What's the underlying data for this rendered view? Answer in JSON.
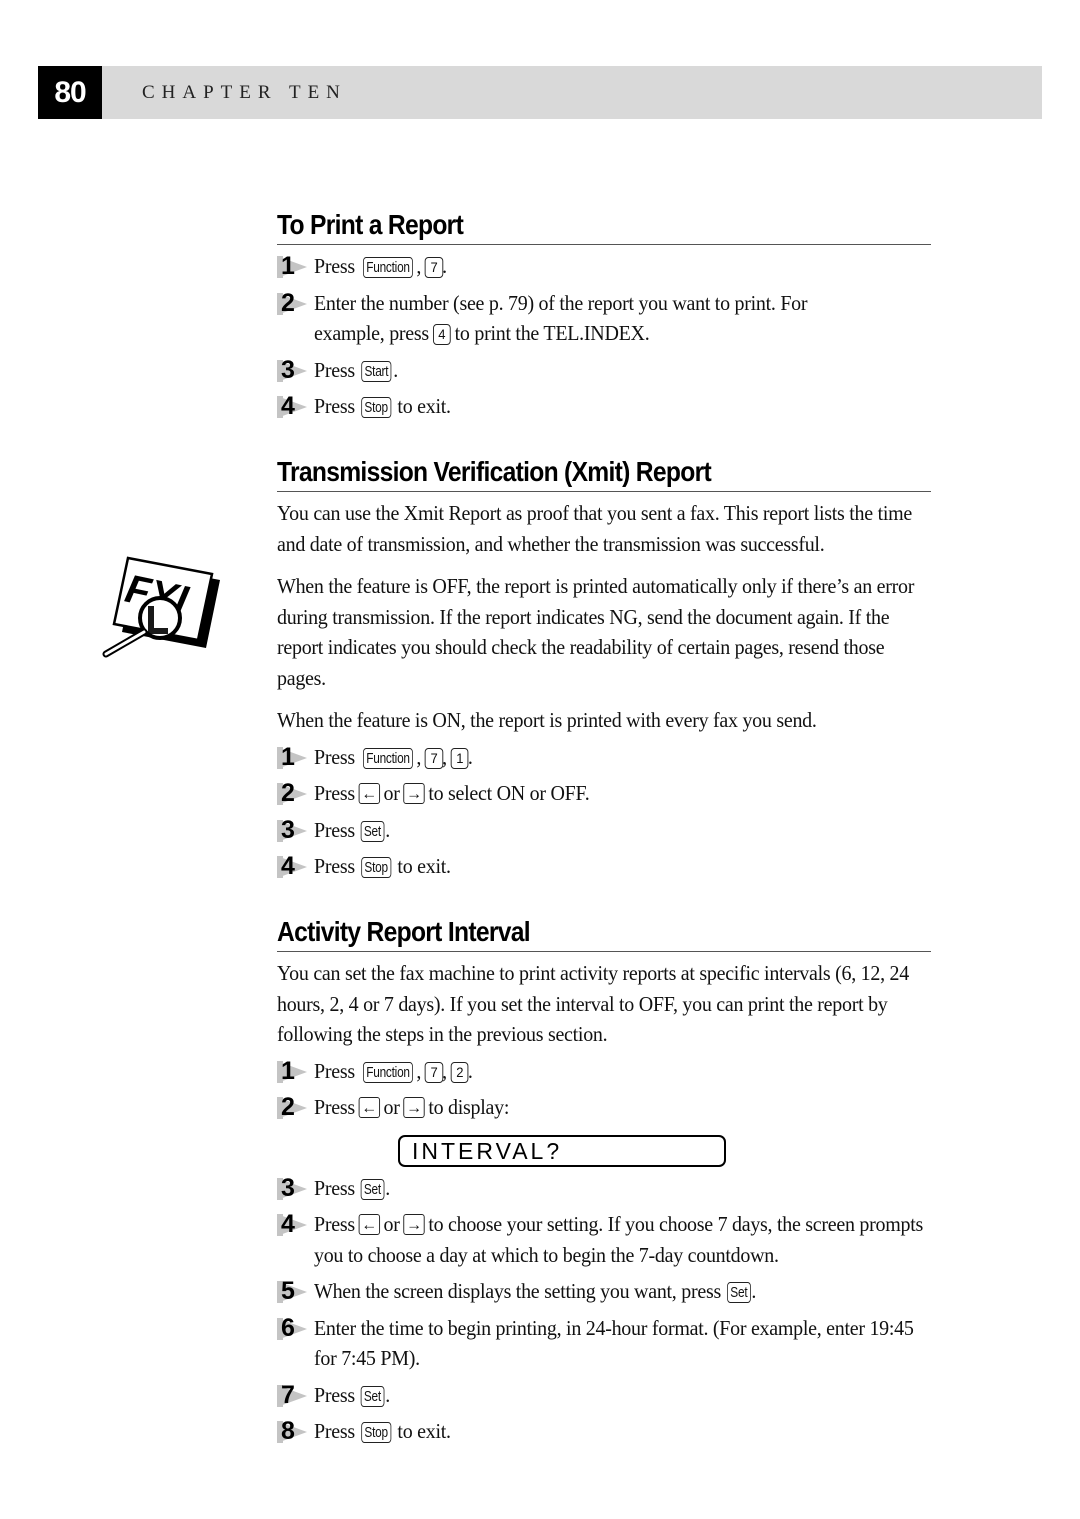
{
  "header": {
    "page_number": "80",
    "chapter": "CHAPTER TEN"
  },
  "fyi_icon": "fyi-magnifier-icon",
  "sections": {
    "print_report": {
      "title": "To Print a Report",
      "steps": [
        {
          "num": "1",
          "parts": [
            "Press ",
            {
              "key": "Function"
            },
            ", ",
            {
              "key": "7"
            },
            "."
          ]
        },
        {
          "num": "2",
          "line1": "Enter the number (see p. 79) of the report you want to print.  For",
          "line2_pre": "example, press ",
          "line2_key": "4",
          "line2_post": " to print the TEL.INDEX."
        },
        {
          "num": "3",
          "pre": "Press ",
          "key": "Start",
          "post": "."
        },
        {
          "num": "4",
          "pre": "Press ",
          "key": "Stop",
          "post": " to exit."
        }
      ]
    },
    "xmit_report": {
      "title": "Transmission Verification (Xmit) Report",
      "paragraphs": [
        "You can use the Xmit Report as proof that you sent a fax.  This report lists the time and date of transmission, and whether the transmission was successful.",
        "When the feature is OFF, the report is printed automatically only if there’s an error during transmission.  If the report indicates NG, send the document again.  If the report indicates you should check the readability of certain pages, resend those pages.",
        "When the feature is ON, the report is printed with every fax you send."
      ],
      "steps": {
        "s1": {
          "num": "1",
          "pre": "Press ",
          "key1": "Function",
          "sep1": ", ",
          "key2": "7",
          "sep2": ", ",
          "key3": "1",
          "post": "."
        },
        "s2": {
          "num": "2",
          "pre": "Press ",
          "left": "←",
          "mid": " or ",
          "right": "→",
          "post": " to select ON or OFF."
        },
        "s3": {
          "num": "3",
          "pre": "Press ",
          "key": "Set",
          "post": "."
        },
        "s4": {
          "num": "4",
          "pre": "Press ",
          "key": "Stop",
          "post": " to exit."
        }
      }
    },
    "activity_report": {
      "title": "Activity Report Interval",
      "paragraph": "You can set the fax machine to print activity reports at specific intervals (6, 12, 24 hours, 2, 4 or 7 days).  If you set the interval to OFF, you can print the report by following the steps in the previous section.",
      "lcd_display": "INTERVAL?",
      "steps": {
        "s1": {
          "num": "1",
          "pre": "Press ",
          "key1": "Function",
          "sep1": ", ",
          "key2": "7",
          "sep2": ", ",
          "key3": "2",
          "post": "."
        },
        "s2": {
          "num": "2",
          "pre": "Press ",
          "left": "←",
          "mid": " or ",
          "right": "→",
          "post": " to display:"
        },
        "s3": {
          "num": "3",
          "pre": "Press ",
          "key": "Set",
          "post": "."
        },
        "s4": {
          "num": "4",
          "pre": "Press ",
          "left": "←",
          "mid": " or ",
          "right": "→",
          "post": " to choose your setting.  If you choose 7 days, the screen prompts you to choose a day at which to begin the 7-day countdown."
        },
        "s5": {
          "num": "5",
          "pre": "When the screen displays the setting you want, press ",
          "key": "Set",
          "post": "."
        },
        "s6": {
          "num": "6",
          "text": "Enter the time to begin printing, in 24-hour format.  (For example, enter 19:45 for 7:45 PM)."
        },
        "s7": {
          "num": "7",
          "pre": "Press ",
          "key": "Set",
          "post": "."
        },
        "s8": {
          "num": "8",
          "pre": "Press ",
          "key": "Stop",
          "post": " to exit."
        }
      }
    }
  }
}
